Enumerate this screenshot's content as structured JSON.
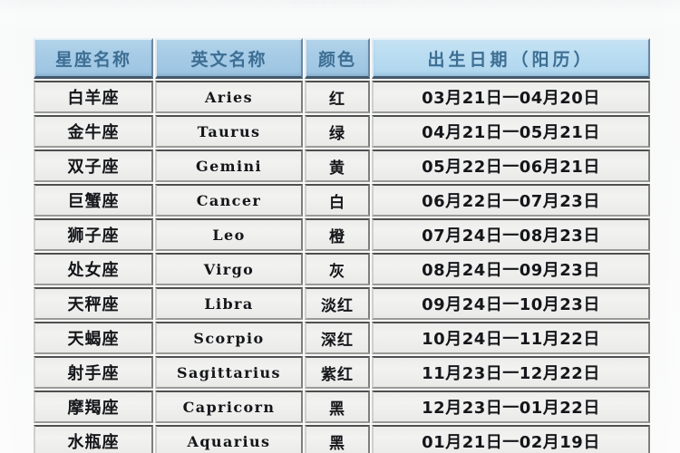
{
  "page": {
    "background_color": "#f7f8f8",
    "top_remnant_text": "· · · ·        ·  ·        · · · ·"
  },
  "table": {
    "header_color_standard": "#a6cbe6",
    "header_color_wide": "#b9dcf1",
    "header_text_color": "#3d6e93",
    "cell_background": "#f0f0ee",
    "border_color": "#4e4e4e",
    "columns": [
      {
        "key": "name",
        "label": "星座名称"
      },
      {
        "key": "en",
        "label": "英文名称"
      },
      {
        "key": "color",
        "label": "颜色"
      },
      {
        "key": "date",
        "label": "出生日期（阳历）"
      }
    ],
    "rows": [
      {
        "name": "白羊座",
        "en": "Aries",
        "color": "红",
        "date": "03月21日一04月20日"
      },
      {
        "name": "金牛座",
        "en": "Taurus",
        "color": "绿",
        "date": "04月21日一05月21日"
      },
      {
        "name": "双子座",
        "en": "Gemini",
        "color": "黄",
        "date": "05月22日一06月21日"
      },
      {
        "name": "巨蟹座",
        "en": "Cancer",
        "color": "白",
        "date": "06月22日一07月23日"
      },
      {
        "name": "狮子座",
        "en": "Leo",
        "color": "橙",
        "date": "07月24日一08月23日"
      },
      {
        "name": "处女座",
        "en": "Virgo",
        "color": "灰",
        "date": "08月24日一09月23日"
      },
      {
        "name": "天秤座",
        "en": "Libra",
        "color": "淡红",
        "date": "09月24日一10月23日"
      },
      {
        "name": "天蝎座",
        "en": "Scorpio",
        "color": "深红",
        "date": "10月24日一11月22日"
      },
      {
        "name": "射手座",
        "en": "Sagittarius",
        "color": "紫红",
        "date": "11月23日一12月22日"
      },
      {
        "name": "摩羯座",
        "en": "Capricorn",
        "color": "黑",
        "date": "12月23日一01月22日"
      },
      {
        "name": "水瓶座",
        "en": "Aquarius",
        "color": "黑",
        "date": "01月21日一02月19日"
      }
    ]
  }
}
